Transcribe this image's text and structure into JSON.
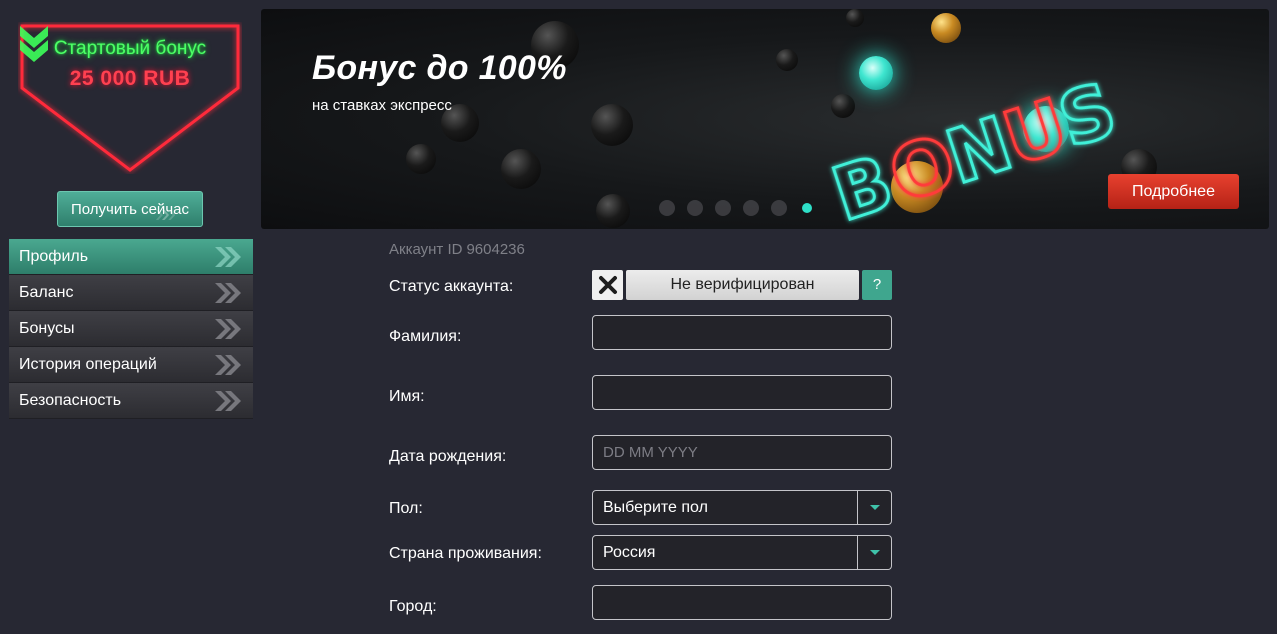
{
  "promo": {
    "title": "Стартовый бонус",
    "amount": "25 000 RUB",
    "cta": "Получить сейчас",
    "frame_color": "#ff2a3a",
    "title_color": "#4dff66"
  },
  "menu": {
    "items": [
      {
        "label": "Профиль",
        "active": true
      },
      {
        "label": "Баланс",
        "active": false
      },
      {
        "label": "Бонусы",
        "active": false
      },
      {
        "label": "История операций",
        "active": false
      },
      {
        "label": "Безопасность",
        "active": false
      }
    ]
  },
  "banner": {
    "title": "Бонус до 100%",
    "subtitle": "на ставках экспресс",
    "neon_word": "BONUS",
    "more_label": "Подробнее",
    "slide_count": 6,
    "active_slide": 6
  },
  "account": {
    "id_label": "Аккаунт ID",
    "id_value": "9604236"
  },
  "form": {
    "status_label": "Статус аккаунта:",
    "status_value": "Не верифицирован",
    "help_label": "?",
    "surname_label": "Фамилия:",
    "surname_value": "",
    "name_label": "Имя:",
    "name_value": "",
    "birthdate_label": "Дата рождения:",
    "birthdate_placeholder": "DD MM YYYY",
    "gender_label": "Пол:",
    "gender_value": "Выберите пол",
    "country_label": "Страна проживания:",
    "country_value": "Россия",
    "city_label": "Город:",
    "city_value": ""
  },
  "colors": {
    "background": "#272833",
    "accent_teal": "#3fa68e",
    "button_red": "#d2321f"
  }
}
